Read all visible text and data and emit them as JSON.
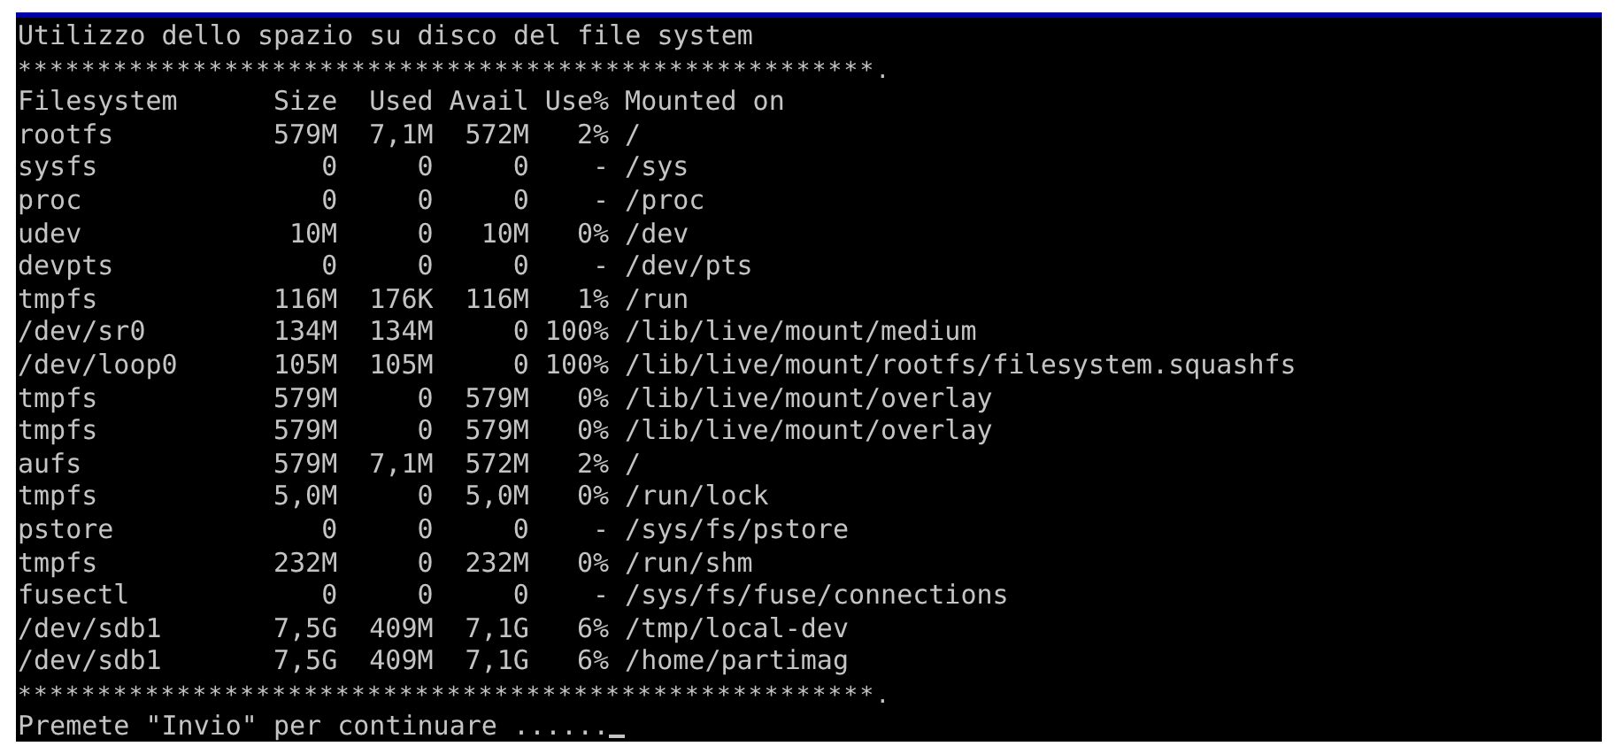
{
  "title": "Utilizzo dello spazio su disco del file system",
  "separator_top": "******************************************************.",
  "table": {
    "columns": [
      "Filesystem",
      "Size",
      "Used",
      "Avail",
      "Use%",
      "Mounted on"
    ],
    "rows": [
      [
        "rootfs",
        "579M",
        "7,1M",
        "572M",
        "2%",
        "/"
      ],
      [
        "sysfs",
        "0",
        "0",
        "0",
        "-",
        "/sys"
      ],
      [
        "proc",
        "0",
        "0",
        "0",
        "-",
        "/proc"
      ],
      [
        "udev",
        "10M",
        "0",
        "10M",
        "0%",
        "/dev"
      ],
      [
        "devpts",
        "0",
        "0",
        "0",
        "-",
        "/dev/pts"
      ],
      [
        "tmpfs",
        "116M",
        "176K",
        "116M",
        "1%",
        "/run"
      ],
      [
        "/dev/sr0",
        "134M",
        "134M",
        "0",
        "100%",
        "/lib/live/mount/medium"
      ],
      [
        "/dev/loop0",
        "105M",
        "105M",
        "0",
        "100%",
        "/lib/live/mount/rootfs/filesystem.squashfs"
      ],
      [
        "tmpfs",
        "579M",
        "0",
        "579M",
        "0%",
        "/lib/live/mount/overlay"
      ],
      [
        "tmpfs",
        "579M",
        "0",
        "579M",
        "0%",
        "/lib/live/mount/overlay"
      ],
      [
        "aufs",
        "579M",
        "7,1M",
        "572M",
        "2%",
        "/"
      ],
      [
        "tmpfs",
        "5,0M",
        "0",
        "5,0M",
        "0%",
        "/run/lock"
      ],
      [
        "pstore",
        "0",
        "0",
        "0",
        "-",
        "/sys/fs/pstore"
      ],
      [
        "tmpfs",
        "232M",
        "0",
        "232M",
        "0%",
        "/run/shm"
      ],
      [
        "fusectl",
        "0",
        "0",
        "0",
        "-",
        "/sys/fs/fuse/connections"
      ],
      [
        "/dev/sdb1",
        "7,5G",
        "409M",
        "7,1G",
        "6%",
        "/tmp/local-dev"
      ],
      [
        "/dev/sdb1",
        "7,5G",
        "409M",
        "7,1G",
        "6%",
        "/home/partimag"
      ]
    ]
  },
  "separator_bottom": "******************************************************.",
  "prompt": "Premete \"Invio\" per continuare ......"
}
